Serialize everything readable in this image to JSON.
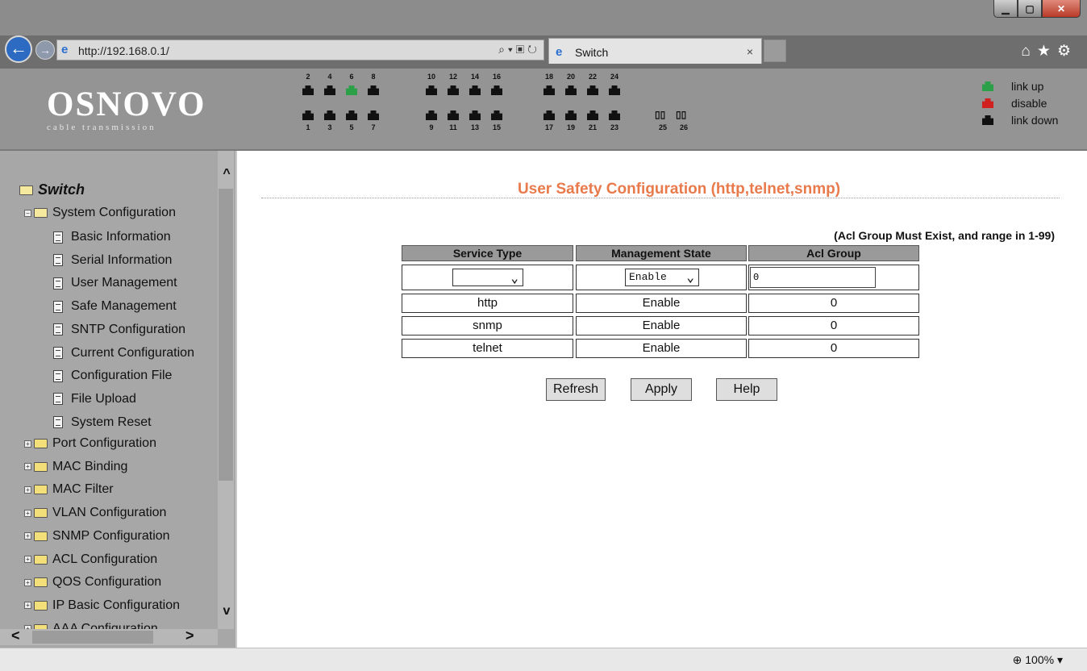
{
  "browser": {
    "url": "http://192.168.0.1/",
    "tab_title": "Switch",
    "tab_close": "×",
    "zoom": "100%"
  },
  "header": {
    "logo": "OSNOVO",
    "logo_sub": "cable transmission",
    "ports_top": [
      "2",
      "4",
      "6",
      "8",
      "10",
      "12",
      "14",
      "16",
      "18",
      "20",
      "22",
      "24"
    ],
    "ports_bottom": [
      "1",
      "3",
      "5",
      "7",
      "9",
      "11",
      "13",
      "15",
      "17",
      "19",
      "21",
      "23"
    ],
    "port_link_up": "6",
    "sfp_ports": [
      "25",
      "26"
    ],
    "legend": [
      {
        "label": "link up",
        "color": "#2ca048"
      },
      {
        "label": "disable",
        "color": "#d02020"
      },
      {
        "label": "link down",
        "color": "#111111"
      }
    ]
  },
  "sidebar": {
    "root": "Switch",
    "open_folder": "System Configuration",
    "children": [
      "Basic Information",
      "Serial Information",
      "User Management",
      "Safe Management",
      "SNTP Configuration",
      "Current Configuration",
      "Configuration File",
      "File Upload",
      "System Reset"
    ],
    "folders": [
      "Port Configuration",
      "MAC Binding",
      "MAC Filter",
      "VLAN Configuration",
      "SNMP Configuration",
      "ACL Configuration",
      "QOS Configuration",
      "IP Basic Configuration",
      "AAA Configuration"
    ]
  },
  "main": {
    "title": "User Safety Configuration (http,telnet,snmp)",
    "note": "(Acl Group Must Exist, and range in 1-99)",
    "columns": [
      "Service Type",
      "Management State",
      "Acl Group"
    ],
    "form": {
      "service_type": "",
      "management_state": "Enable",
      "acl_group": "0"
    },
    "rows": [
      {
        "service": "http",
        "state": "Enable",
        "acl": "0"
      },
      {
        "service": "snmp",
        "state": "Enable",
        "acl": "0"
      },
      {
        "service": "telnet",
        "state": "Enable",
        "acl": "0"
      }
    ],
    "buttons": {
      "refresh": "Refresh",
      "apply": "Apply",
      "help": "Help"
    }
  }
}
